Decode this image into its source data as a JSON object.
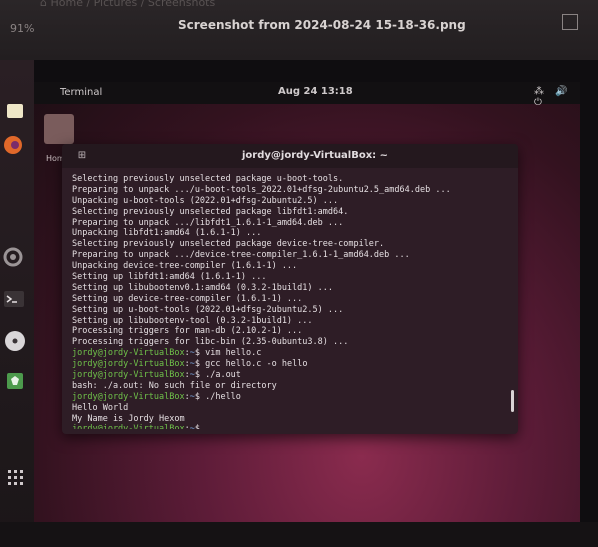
{
  "viewer": {
    "path": "⌂ Home / Pictures / Screenshots",
    "zoom": "91%",
    "title": "Screenshot from 2024-08-24 15-18-36.png"
  },
  "dock": {
    "items": [
      {
        "name": "files-icon"
      },
      {
        "name": "firefox-icon"
      },
      {
        "name": "settings-icon"
      },
      {
        "name": "terminal-icon"
      },
      {
        "name": "disc-icon"
      },
      {
        "name": "trash-icon"
      },
      {
        "name": "apps-grid-icon"
      }
    ]
  },
  "topbar": {
    "activities": "Terminal",
    "clock": "Aug 24  13:18",
    "sysicons": "⁂ 🔊 ⏻"
  },
  "desktop": {
    "home_label": "Hom"
  },
  "terminal": {
    "title": "jordy@jordy-VirtualBox: ~",
    "lines": [
      {
        "type": "out",
        "text": "Selecting previously unselected package u-boot-tools."
      },
      {
        "type": "out",
        "text": "Preparing to unpack .../u-boot-tools_2022.01+dfsg-2ubuntu2.5_amd64.deb ..."
      },
      {
        "type": "out",
        "text": "Unpacking u-boot-tools (2022.01+dfsg-2ubuntu2.5) ..."
      },
      {
        "type": "out",
        "text": "Selecting previously unselected package libfdt1:amd64."
      },
      {
        "type": "out",
        "text": "Preparing to unpack .../libfdt1_1.6.1-1_amd64.deb ..."
      },
      {
        "type": "out",
        "text": "Unpacking libfdt1:amd64 (1.6.1-1) ..."
      },
      {
        "type": "out",
        "text": "Selecting previously unselected package device-tree-compiler."
      },
      {
        "type": "out",
        "text": "Preparing to unpack .../device-tree-compiler_1.6.1-1_amd64.deb ..."
      },
      {
        "type": "out",
        "text": "Unpacking device-tree-compiler (1.6.1-1) ..."
      },
      {
        "type": "out",
        "text": "Setting up libfdt1:amd64 (1.6.1-1) ..."
      },
      {
        "type": "out",
        "text": "Setting up libubootenv0.1:amd64 (0.3.2-1build1) ..."
      },
      {
        "type": "out",
        "text": "Setting up device-tree-compiler (1.6.1-1) ..."
      },
      {
        "type": "out",
        "text": "Setting up u-boot-tools (2022.01+dfsg-2ubuntu2.5) ..."
      },
      {
        "type": "out",
        "text": "Setting up libubootenv-tool (0.3.2-1build1) ..."
      },
      {
        "type": "out",
        "text": "Processing triggers for man-db (2.10.2-1) ..."
      },
      {
        "type": "out",
        "text": "Processing triggers for libc-bin (2.35-0ubuntu3.8) ..."
      },
      {
        "type": "cmd",
        "user": "jordy@jordy-VirtualBox",
        "path": "~",
        "text": "vim hello.c"
      },
      {
        "type": "cmd",
        "user": "jordy@jordy-VirtualBox",
        "path": "~",
        "text": "gcc hello.c -o hello"
      },
      {
        "type": "cmd",
        "user": "jordy@jordy-VirtualBox",
        "path": "~",
        "text": "./a.out"
      },
      {
        "type": "out",
        "text": "bash: ./a.out: No such file or directory"
      },
      {
        "type": "cmd",
        "user": "jordy@jordy-VirtualBox",
        "path": "~",
        "text": "./hello"
      },
      {
        "type": "out",
        "text": "Hello World"
      },
      {
        "type": "out",
        "text": "My Name is Jordy Hexom"
      },
      {
        "type": "cmd",
        "user": "jordy@jordy-VirtualBox",
        "path": "~",
        "text": ""
      }
    ]
  },
  "colors": {
    "prompt_user": "#6fc24a",
    "prompt_path": "#7aa7e0",
    "terminal_bg": "#2e1d26",
    "wallpaper_accent": "#8a2b4e"
  }
}
